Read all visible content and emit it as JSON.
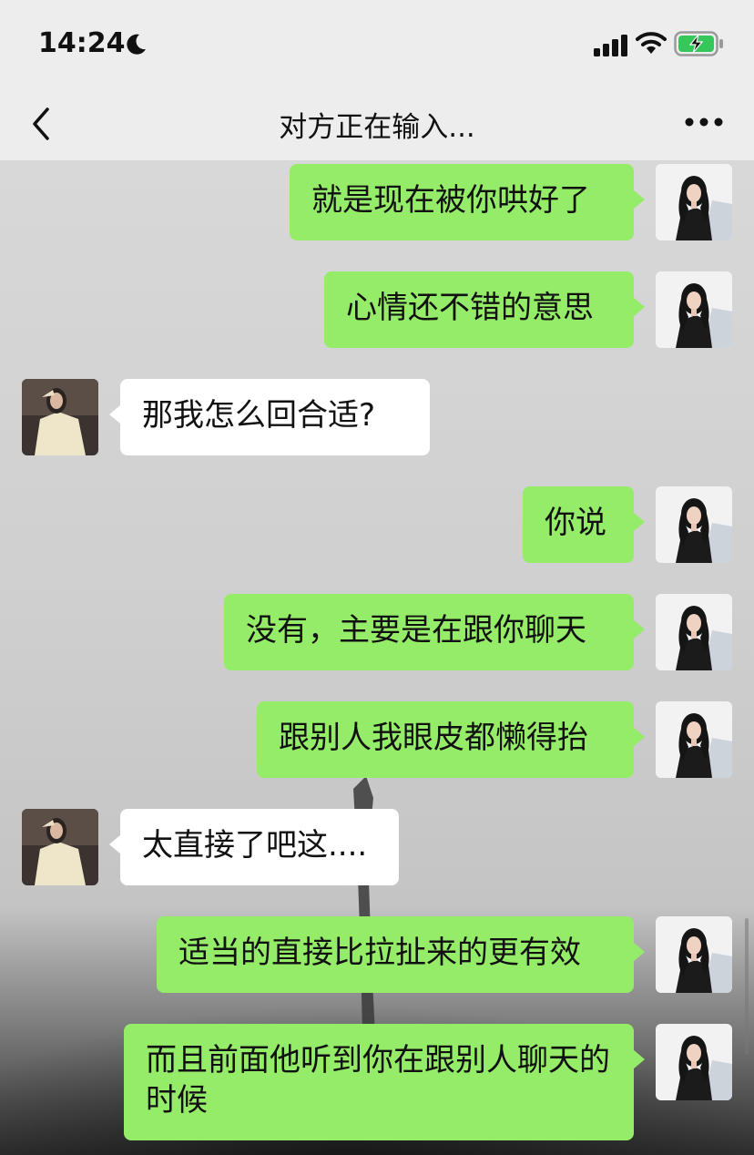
{
  "status_bar": {
    "time": "14:24",
    "icons": [
      "moon-icon",
      "signal-icon",
      "wifi-icon",
      "battery-charging-icon"
    ]
  },
  "nav": {
    "title": "对方正在输入...",
    "back_icon": "chevron-left-icon",
    "more_icon": "more-dots-icon"
  },
  "colors": {
    "my_bubble": "#95ec69",
    "their_bubble": "#ffffff",
    "header_bg": "#ededed"
  },
  "messages": [
    {
      "sender": "me",
      "text": "就是现在被你哄好了"
    },
    {
      "sender": "me",
      "text": "心情还不错的意思"
    },
    {
      "sender": "them",
      "text": "那我怎么回合适?"
    },
    {
      "sender": "me",
      "text": "你说"
    },
    {
      "sender": "me",
      "text": "没有，主要是在跟你聊天"
    },
    {
      "sender": "me",
      "text": "跟别人我眼皮都懒得抬"
    },
    {
      "sender": "them",
      "text": "太直接了吧这...."
    },
    {
      "sender": "me",
      "text": "适当的直接比拉扯来的更有效"
    },
    {
      "sender": "me",
      "text": "而且前面他听到你在跟别人聊天的时候"
    }
  ]
}
